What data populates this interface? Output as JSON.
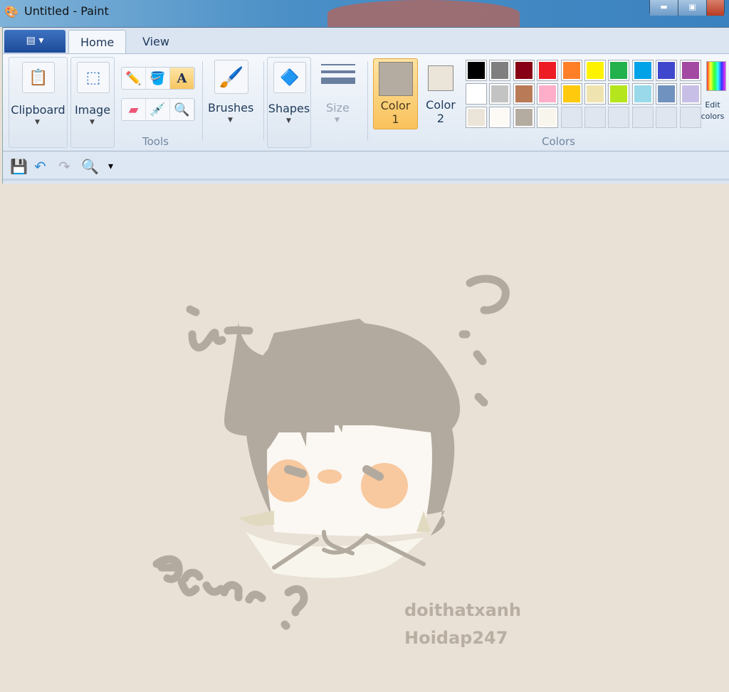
{
  "window": {
    "title": "Untitled - Paint"
  },
  "tabs": [
    {
      "label": "Home",
      "active": true
    },
    {
      "label": "View",
      "active": false
    }
  ],
  "ribbon": {
    "clipboard": "Clipboard",
    "image": "Image",
    "tools": "Tools",
    "brushes": "Brushes",
    "shapes": "Shapes",
    "size": "Size",
    "color1": {
      "label": "Color",
      "num": "1",
      "value": "#b5aca1"
    },
    "color2": {
      "label": "Color",
      "num": "2",
      "value": "#ebe4d9"
    },
    "colors_group": "Colors",
    "edit_colors": "Edit colors",
    "palette": [
      "#000000",
      "#7f7f7f",
      "#880015",
      "#ed1c24",
      "#ff7f27",
      "#fff200",
      "#22b14c",
      "#00a2e8",
      "#3f48cc",
      "#a349a4",
      "#ffffff",
      "#c3c3c3",
      "#b97a57",
      "#ffaec9",
      "#ffc90e",
      "#efe4b0",
      "#b5e61d",
      "#99d9ea",
      "#7092be",
      "#c8bfe7",
      "#ebe4d9",
      "#fdfaf6",
      "#b5aca1",
      "#f8f6ec",
      "",
      "",
      "",
      "",
      "",
      ""
    ]
  },
  "canvas": {
    "background": "#e9e1d6",
    "watermark": [
      "doithatxanh",
      "Hoidap247"
    ]
  }
}
